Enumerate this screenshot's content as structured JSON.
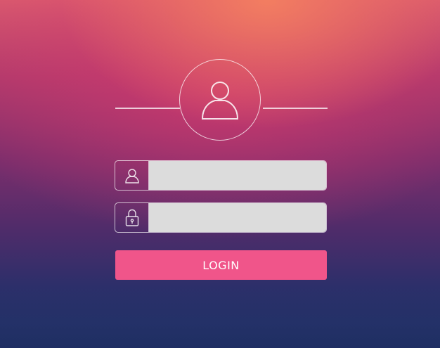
{
  "login_form": {
    "avatar_icon": "user-avatar-icon",
    "username": {
      "icon": "user-icon",
      "value": "",
      "placeholder": ""
    },
    "password": {
      "icon": "lock-icon",
      "value": "",
      "placeholder": ""
    },
    "login_button_label": "LOGIN"
  },
  "colors": {
    "button": "#f0558a",
    "input_background": "#dcdcdc",
    "outline": "#ffffff"
  }
}
